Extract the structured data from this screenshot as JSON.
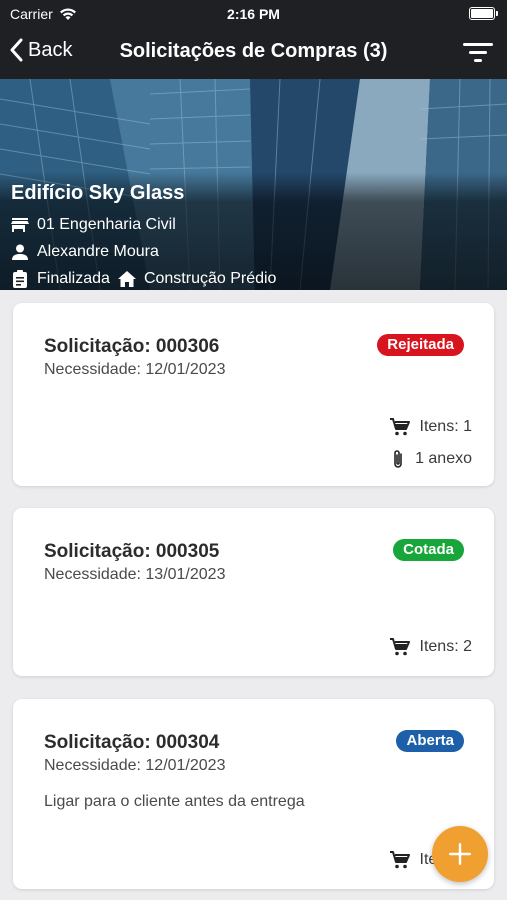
{
  "status_bar": {
    "carrier": "Carrier",
    "time": "2:16 PM"
  },
  "nav": {
    "back_label": "Back",
    "title": "Solicitações de Compras (3)"
  },
  "hero": {
    "building": "Edifício Sky Glass",
    "department": "01 Engenharia Civil",
    "person": "Alexandre Moura",
    "status": "Finalizada",
    "project": "Construção Prédio"
  },
  "requests": [
    {
      "number": "Solicitação: 000306",
      "need": "Necessidade: 12/01/2023",
      "status": "Rejeitada",
      "status_color": "#d8141e",
      "items": "Itens: 1",
      "attachments": "1 anexo"
    },
    {
      "number": "Solicitação: 000305",
      "need": "Necessidade: 13/01/2023",
      "status": "Cotada",
      "status_color": "#18a63a",
      "items": "Itens: 2"
    },
    {
      "number": "Solicitação: 000304",
      "need": "Necessidade: 12/01/2023",
      "status": "Aberta",
      "status_color": "#1d5fa8",
      "note": "Ligar para o cliente antes da entrega",
      "items": "Itens: 1"
    }
  ],
  "icons": [
    "wifi-icon",
    "battery-icon",
    "back-chevron-icon",
    "filter-icon",
    "store-icon",
    "person-icon",
    "clipboard-icon",
    "home-icon",
    "cart-icon",
    "paperclip-icon",
    "plus-icon"
  ],
  "colors": {
    "nav_bg": "#1f2023",
    "fab": "#f0a030",
    "page_bg": "#ececee"
  }
}
